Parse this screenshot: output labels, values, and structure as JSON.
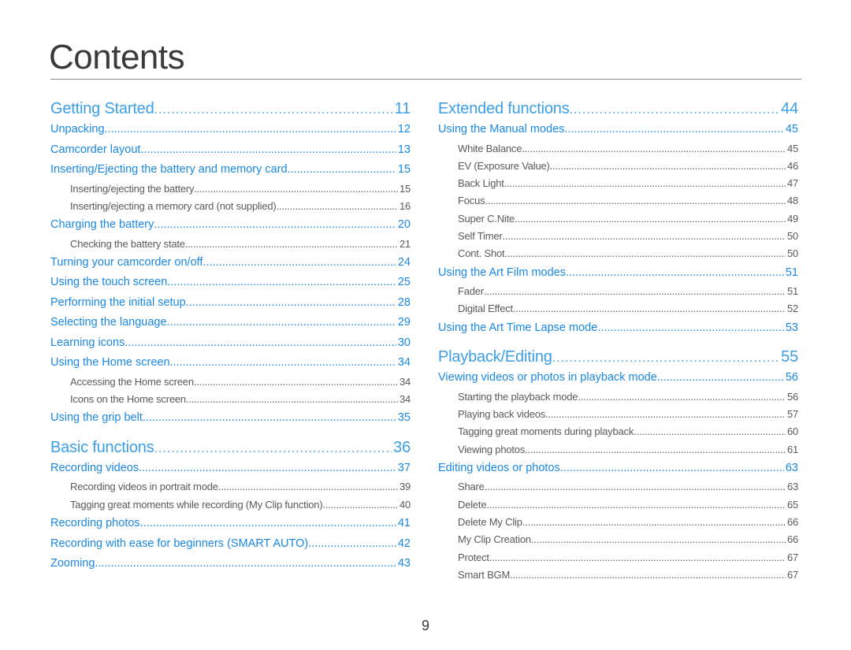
{
  "page": {
    "title": "Contents",
    "page_number": "9"
  },
  "colors": {
    "section_heading": "#3c9fe6",
    "entry_link": "#1a88e3",
    "subentry_text": "#5a5a5a",
    "title_text": "#3a3a3a",
    "rule": "#8a8a8a"
  },
  "left_column": [
    {
      "level": "section",
      "title": "Getting Started",
      "page": "11"
    },
    {
      "level": "entry",
      "title": "Unpacking",
      "page": "12"
    },
    {
      "level": "entry",
      "title": "Camcorder layout",
      "page": "13"
    },
    {
      "level": "entry",
      "title": "Inserting/Ejecting the battery and memory card",
      "page": "15"
    },
    {
      "level": "sub",
      "title": "Inserting/ejecting the battery",
      "page": "15"
    },
    {
      "level": "sub",
      "title": "Inserting/ejecting a memory card (not supplied)",
      "page": "16"
    },
    {
      "level": "entry",
      "title": "Charging the battery",
      "page": "20"
    },
    {
      "level": "sub",
      "title": "Checking the battery state",
      "page": "21"
    },
    {
      "level": "entry",
      "title": "Turning your camcorder on/off",
      "page": "24"
    },
    {
      "level": "entry",
      "title": "Using the touch screen",
      "page": "25"
    },
    {
      "level": "entry",
      "title": "Performing the initial setup",
      "page": "28"
    },
    {
      "level": "entry",
      "title": "Selecting the language",
      "page": "29"
    },
    {
      "level": "entry",
      "title": "Learning icons",
      "page": "30"
    },
    {
      "level": "entry",
      "title": "Using the Home screen",
      "page": "34"
    },
    {
      "level": "sub",
      "title": "Accessing the Home screen",
      "page": "34"
    },
    {
      "level": "sub",
      "title": "Icons on the Home screen",
      "page": "34"
    },
    {
      "level": "entry",
      "title": "Using the grip belt",
      "page": "35"
    },
    {
      "level": "section",
      "title": "Basic functions",
      "page": "36"
    },
    {
      "level": "entry",
      "title": "Recording videos",
      "page": "37"
    },
    {
      "level": "sub",
      "title": "Recording videos in portrait mode",
      "page": "39"
    },
    {
      "level": "sub",
      "title": "Tagging great moments while recording (My Clip function)",
      "page": "40"
    },
    {
      "level": "entry",
      "title": "Recording photos",
      "page": "41"
    },
    {
      "level": "entry",
      "title": "Recording with ease for beginners (SMART AUTO)",
      "page": "42"
    },
    {
      "level": "entry",
      "title": "Zooming",
      "page": "43"
    }
  ],
  "right_column": [
    {
      "level": "section",
      "title": "Extended functions",
      "page": "44"
    },
    {
      "level": "entry",
      "title": "Using the Manual modes",
      "page": "45"
    },
    {
      "level": "sub",
      "title": "White Balance",
      "page": "45"
    },
    {
      "level": "sub",
      "title": "EV (Exposure Value)",
      "page": "46"
    },
    {
      "level": "sub",
      "title": "Back Light",
      "page": "47"
    },
    {
      "level": "sub",
      "title": "Focus",
      "page": "48"
    },
    {
      "level": "sub",
      "title": "Super C.Nite",
      "page": "49"
    },
    {
      "level": "sub",
      "title": "Self Timer",
      "page": "50"
    },
    {
      "level": "sub",
      "title": "Cont. Shot",
      "page": "50"
    },
    {
      "level": "entry",
      "title": "Using the Art Film modes",
      "page": "51"
    },
    {
      "level": "sub",
      "title": "Fader",
      "page": "51"
    },
    {
      "level": "sub",
      "title": "Digital Effect",
      "page": "52"
    },
    {
      "level": "entry",
      "title": "Using the Art Time Lapse mode",
      "page": "53"
    },
    {
      "level": "section",
      "title": "Playback/Editing",
      "page": "55"
    },
    {
      "level": "entry",
      "title": "Viewing videos or photos in playback mode",
      "page": "56"
    },
    {
      "level": "sub",
      "title": "Starting the playback mode",
      "page": "56"
    },
    {
      "level": "sub",
      "title": "Playing back videos",
      "page": "57"
    },
    {
      "level": "sub",
      "title": "Tagging great moments during playback",
      "page": "60"
    },
    {
      "level": "sub",
      "title": "Viewing photos",
      "page": "61"
    },
    {
      "level": "entry",
      "title": "Editing videos or photos",
      "page": "63"
    },
    {
      "level": "sub",
      "title": "Share",
      "page": "63"
    },
    {
      "level": "sub",
      "title": "Delete",
      "page": "65"
    },
    {
      "level": "sub",
      "title": "Delete My Clip",
      "page": "66"
    },
    {
      "level": "sub",
      "title": "My Clip Creation",
      "page": "66"
    },
    {
      "level": "sub",
      "title": "Protect",
      "page": "67"
    },
    {
      "level": "sub",
      "title": "Smart BGM",
      "page": "67"
    }
  ]
}
